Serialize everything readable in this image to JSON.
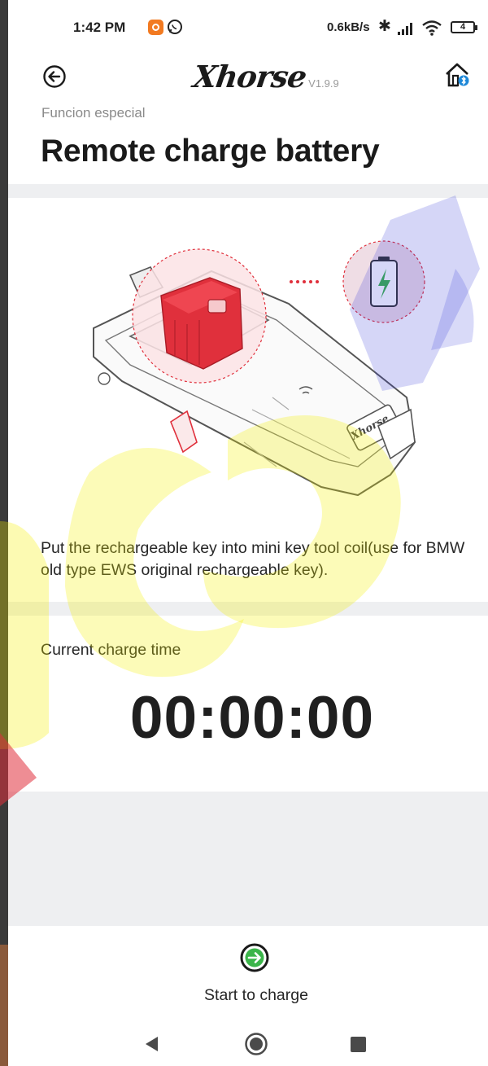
{
  "status_bar": {
    "time": "1:42 PM",
    "net_speed": "0.6kB/s",
    "battery": "4",
    "icons": [
      "app-notification-icon",
      "whatsapp-icon",
      "bluetooth-icon",
      "signal-icon",
      "wifi-icon",
      "battery-icon"
    ]
  },
  "header": {
    "brand": "Xhorse",
    "version": "V1.9.9",
    "section": "Funcion especial",
    "title": "Remote charge battery",
    "icons": [
      "back-arrow-icon",
      "home-bluetooth-icon"
    ]
  },
  "instruction": "Put the rechargeable key into mini key tool coil(use for BMW old type EWS original rechargeable key).",
  "charge": {
    "label": "Current charge time",
    "time": "00:00:00"
  },
  "actions": {
    "start_label": "Start to charge",
    "start_icon": "arrow-right-circle-icon"
  },
  "colors": {
    "accent_green": "#3bb54a",
    "highlight_red": "#e0303c"
  },
  "nav_bar": {
    "icons": [
      "nav-back-icon",
      "nav-home-icon",
      "nav-recent-icon"
    ]
  }
}
